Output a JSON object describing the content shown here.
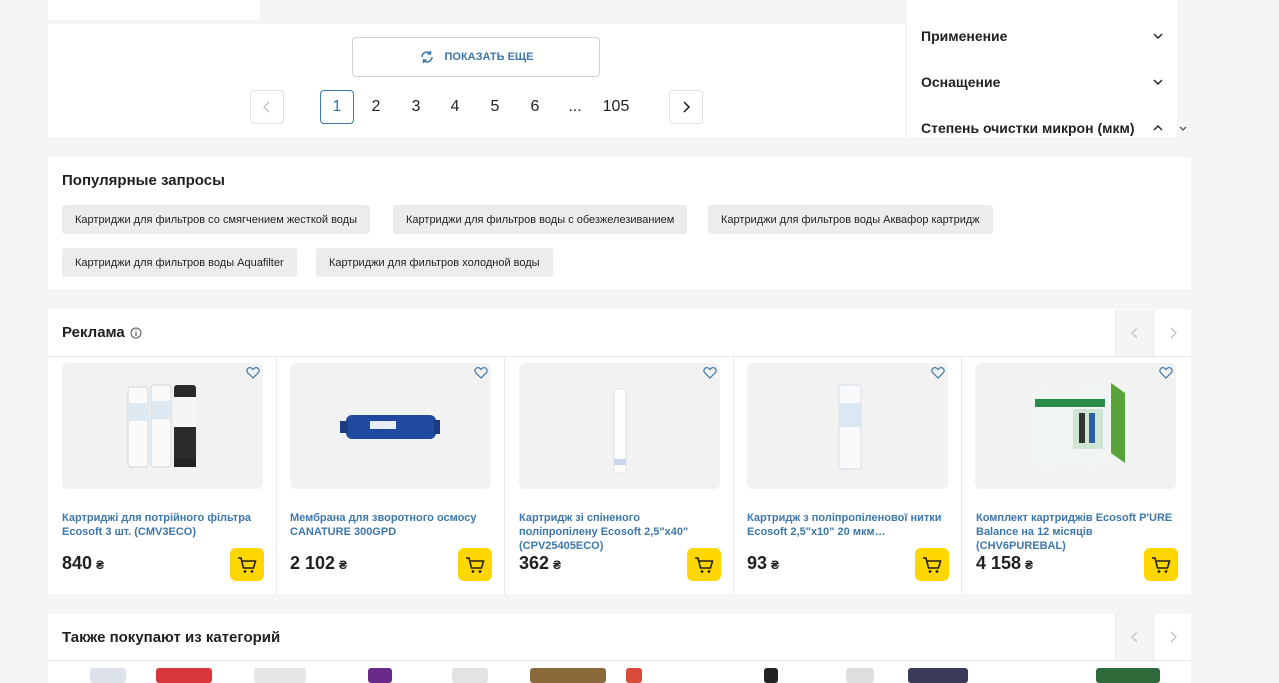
{
  "pagination": {
    "show_more_label": "ПОКАЗАТЬ ЕЩЕ",
    "pages": [
      "1",
      "2",
      "3",
      "4",
      "5",
      "6",
      "...",
      "105"
    ],
    "current_page": "1"
  },
  "filters": {
    "items": [
      {
        "label": "Применение",
        "state": "collapsed"
      },
      {
        "label": "Оснащение",
        "state": "collapsed"
      },
      {
        "label": "Степень очистки микрон (мкм)",
        "state": "expanded"
      }
    ]
  },
  "popular": {
    "title": "Популярные запросы",
    "chips": [
      "Картриджи для фильтров со смягчением жесткой воды",
      "Картриджи для фильтров воды с обезжелезиванием",
      "Картриджи для фильтров воды Аквафор картридж",
      "Картриджи для фильтров воды Aquafilter",
      "Картриджи для фильтров холодной воды"
    ]
  },
  "ads": {
    "title": "Реклама",
    "currency": "₴",
    "products": [
      {
        "title": "Картриджі для потрійного фільтра Ecosoft 3 шт. (CMV3ECO)",
        "price": "840",
        "image": "three-cartridges"
      },
      {
        "title": "Мембрана для зворотного осмосу CANATURE 300GPD",
        "price": "2 102",
        "image": "membrane"
      },
      {
        "title": "Картридж зі спіненого поліпропілену Ecosoft 2,5\"x40\" (CPV25405ECO)",
        "price": "362",
        "image": "long-cartridge"
      },
      {
        "title": "Картридж з поліпропіленової нитки Ecosoft 2,5\"x10\" 20 мкм…",
        "price": "93",
        "image": "string-cartridge"
      },
      {
        "title": "Комплект картриджів Ecosoft P'URE Balance на 12 місяців (CHV6PUREBAL)",
        "price": "4 158",
        "image": "kit-box"
      }
    ]
  },
  "also_buy": {
    "title": "Также покупают из категорий"
  },
  "colors": {
    "accent": "#3e77aa",
    "cart": "#ffd700",
    "background": "#f5f5f5"
  }
}
